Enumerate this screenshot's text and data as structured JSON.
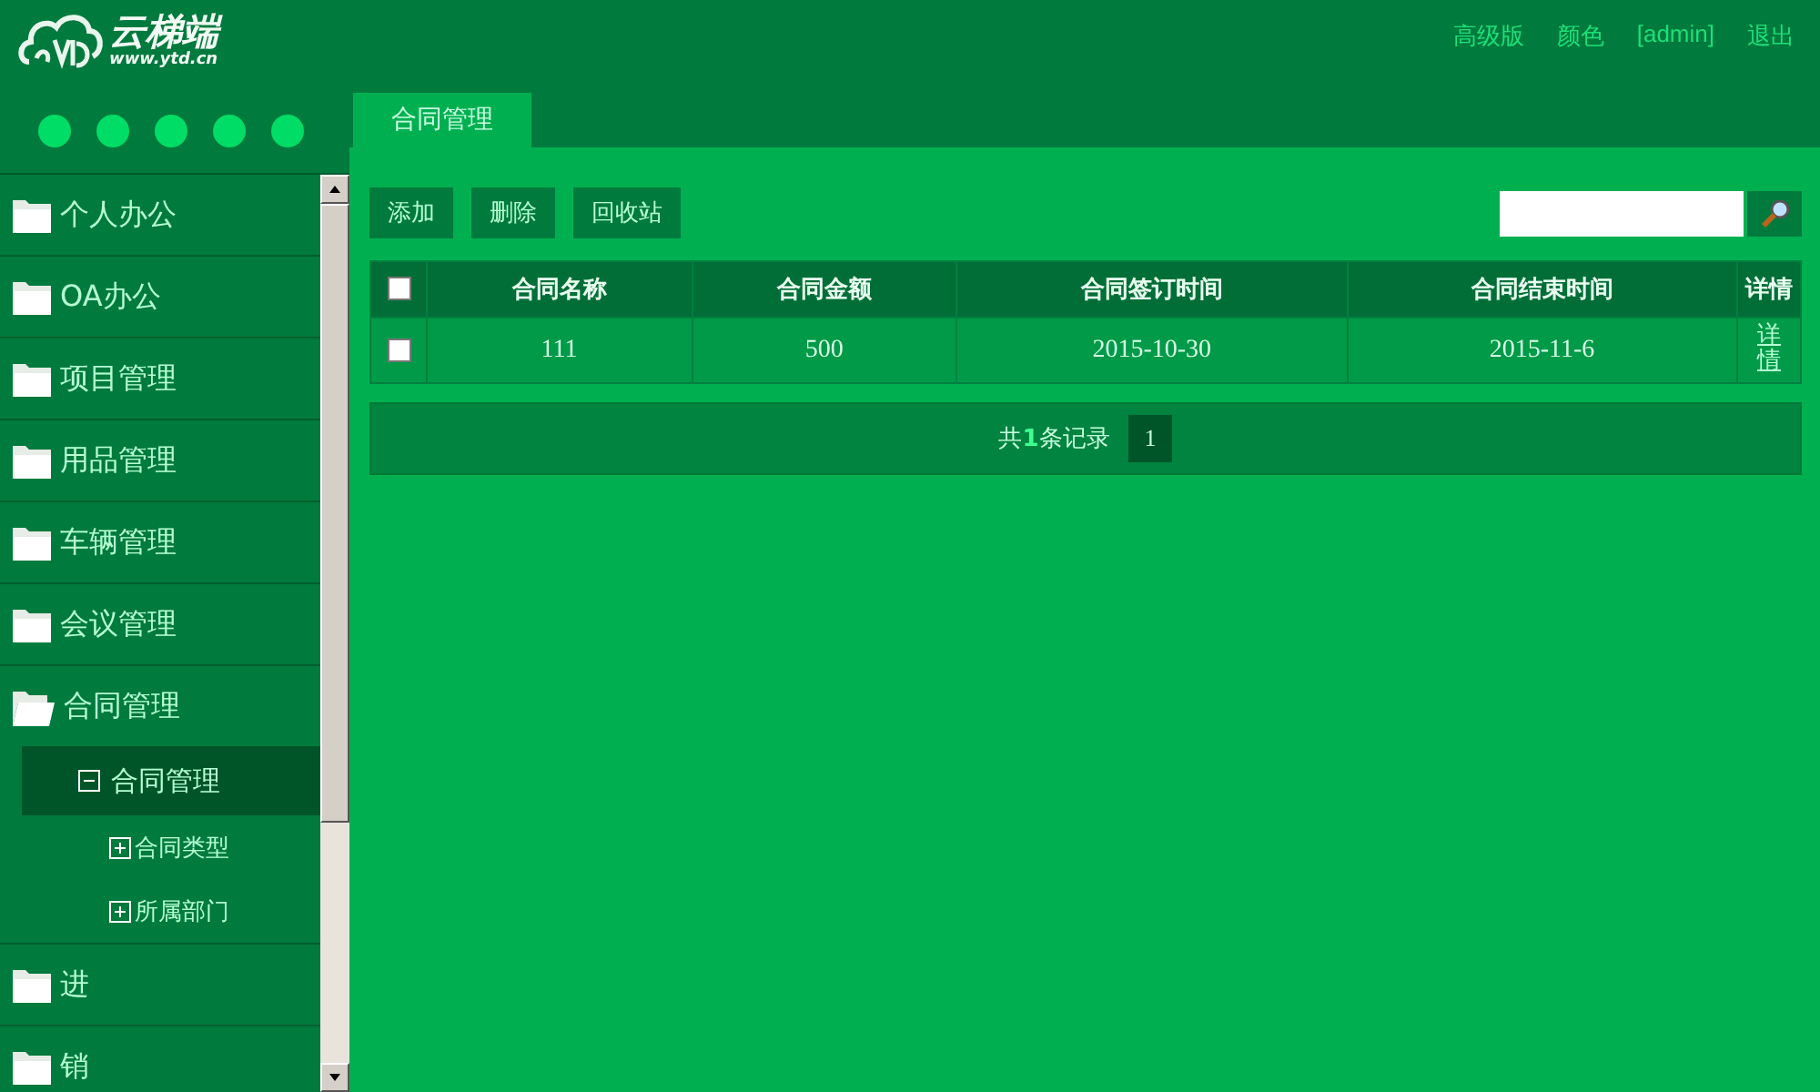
{
  "header": {
    "logo_text": "云梯端",
    "logo_url": "www.ytd.cn",
    "links": [
      "高级版",
      "颜色",
      "[admin]",
      "退出"
    ]
  },
  "sidebar": {
    "items": [
      {
        "label": "个人办公",
        "expanded": false
      },
      {
        "label": "OA办公",
        "expanded": false
      },
      {
        "label": "项目管理",
        "expanded": false
      },
      {
        "label": "用品管理",
        "expanded": false
      },
      {
        "label": "车辆管理",
        "expanded": false
      },
      {
        "label": "会议管理",
        "expanded": false
      },
      {
        "label": "合同管理",
        "expanded": true,
        "children": [
          {
            "label": "合同管理",
            "expanded": true,
            "selected": true,
            "children": [
              {
                "label": "合同类型",
                "expanded": false,
                "selected": false
              },
              {
                "label": "所属部门",
                "expanded": false,
                "selected": false
              }
            ]
          }
        ]
      },
      {
        "label": "进",
        "expanded": false
      },
      {
        "label": "销",
        "expanded": false
      }
    ]
  },
  "tabs": [
    {
      "label": "合同管理",
      "selected": true
    }
  ],
  "toolbar": {
    "buttons": [
      "添加",
      "删除",
      "回收站"
    ]
  },
  "table": {
    "select_all_checked": false,
    "columns": [
      "合同名称",
      "合同金额",
      "合同签订时间",
      "合同结束时间",
      "详情"
    ],
    "rows": [
      {
        "checked": false,
        "cells": [
          "111",
          "500",
          "2015-10-30",
          "2015-11-6"
        ],
        "link": "详情"
      }
    ]
  },
  "pagination": {
    "summary": "共**1**条记录",
    "pages": [
      {
        "label": "1",
        "selected": true
      }
    ]
  }
}
